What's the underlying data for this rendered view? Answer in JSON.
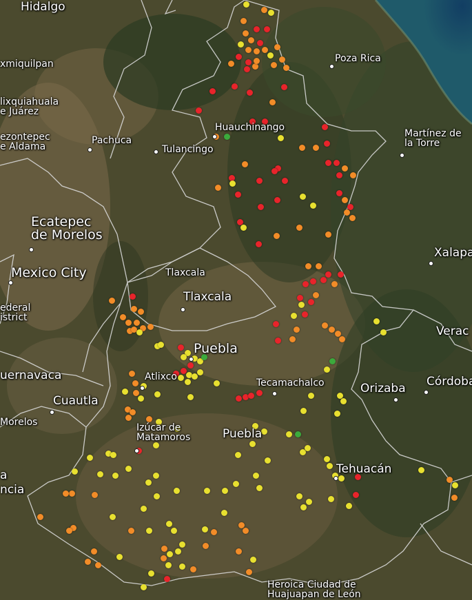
{
  "map": {
    "labels": {
      "hidalgo": "Hidalgo",
      "ixmiquilpan": "xmiquilpan",
      "ixmiquilpan_partial": "xmiquilpan",
      "mixquiahuala_1": "lixquiahuala",
      "mixquiahuala_2": "e Juárez",
      "tezontepec_1": "ezontepec",
      "tezontepec_2": "e Aldama",
      "pachuca": "Pachuca",
      "tulancingo": "Tulancingo",
      "huauchinango": "Huauchinango",
      "poza_rica": "Poza Rica",
      "martinez_1": "Martínez de",
      "martinez_2": "la Torre",
      "ecatepec_1": "Ecatepec",
      "ecatepec_2": "de Morelos",
      "mexico_city": "Mexico City",
      "federal_1": "ederal",
      "federal_2": "istrict",
      "xalapa": "Xalapa",
      "tlaxcala_state": "Tlaxcala",
      "tlaxcala_city": "Tlaxcala",
      "puebla_city": "Puebla",
      "veracruz": "Verac",
      "cuernavaca": "uernavaca",
      "atlixco": "Atlixco",
      "tecamachalco": "Tecamachalco",
      "orizaba": "Orizaba",
      "cordoba": "Córdoba",
      "cuautla": "Cuautla",
      "morelos": "Morelos",
      "izucar_1": "Izúcar de",
      "izucar_2": "Matamoros",
      "puebla_state": "Puebla",
      "tehuacan": "Tehuacán",
      "left_a": "a",
      "left_ncia": "ncia",
      "huajuapan_1": "Heroica Ciudad de",
      "huajuapan_2": "Huajuapan de León"
    },
    "colors": {
      "high": "#e8242b",
      "medium": "#f28c28",
      "low": "#e8e030",
      "minimal": "#3caa3c",
      "border": "#d8d8d8",
      "sea": "#1c4a6b"
    },
    "icons": [
      "city-marker-icon"
    ]
  }
}
